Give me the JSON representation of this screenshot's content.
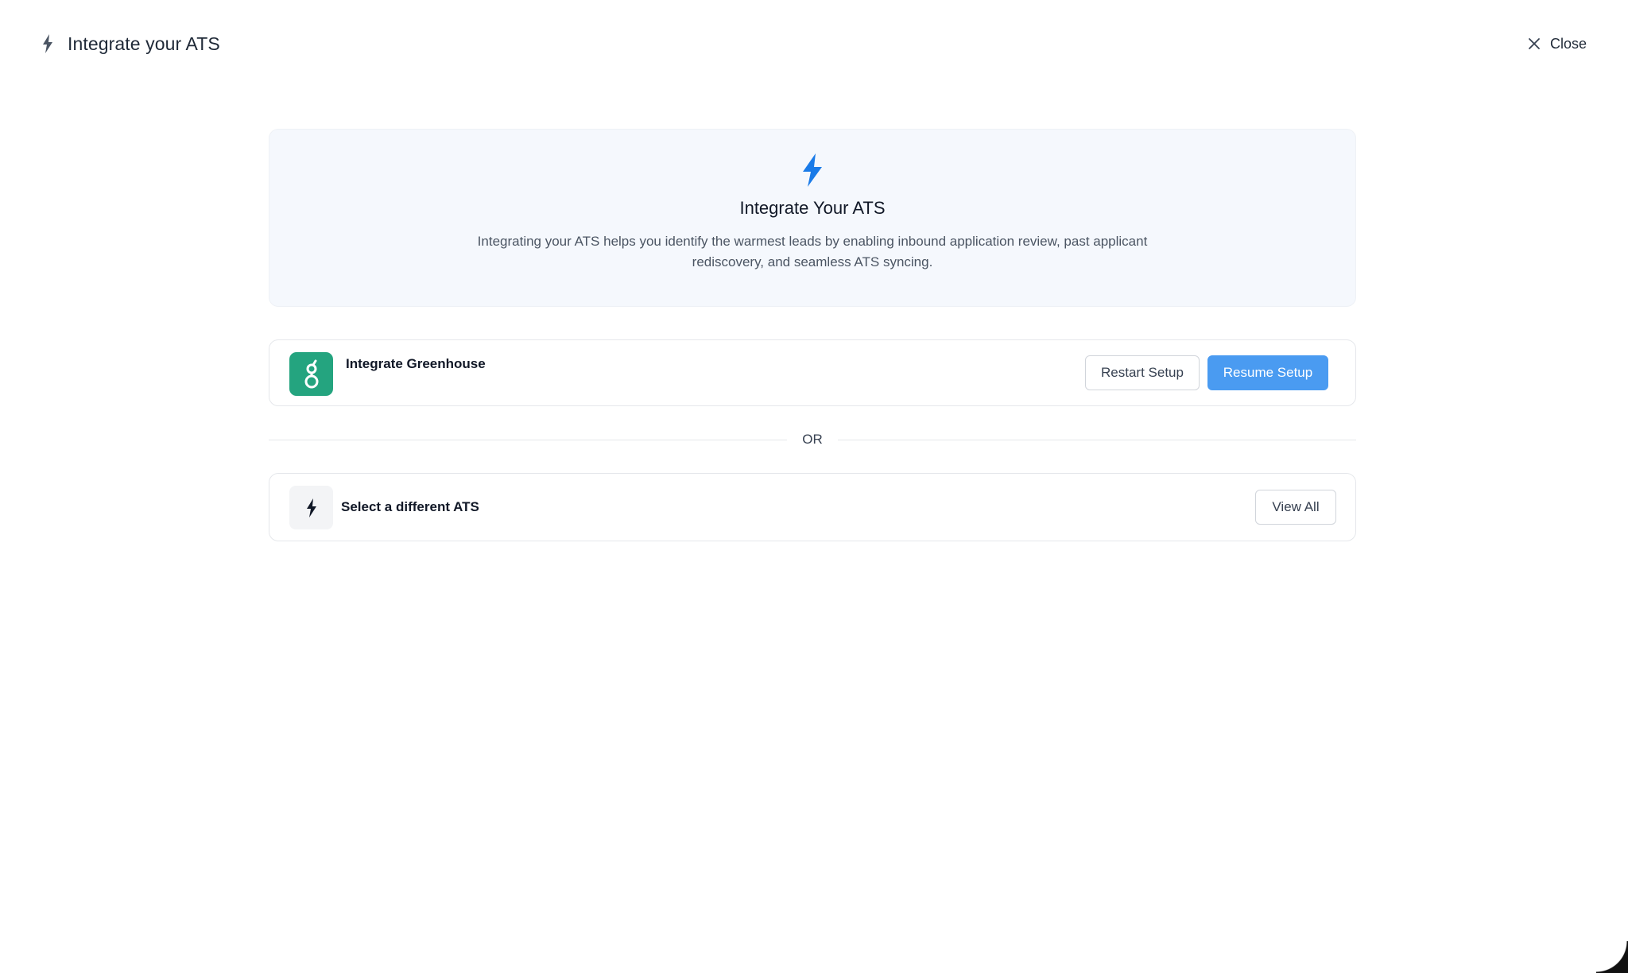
{
  "header": {
    "icon": "lightning-icon",
    "title": "Integrate your ATS",
    "close_label": "Close",
    "close_icon": "close-icon"
  },
  "hero": {
    "icon": "lightning-icon",
    "accent_color": "#1a7be8",
    "title": "Integrate Your ATS",
    "description": "Integrating your ATS helps you identify the warmest leads by enabling inbound application review, past applicant rediscovery, and seamless ATS syncing."
  },
  "greenhouse_card": {
    "logo_icon": "greenhouse-logo-icon",
    "logo_color": "#24a47f",
    "label": "Integrate Greenhouse",
    "restart_label": "Restart Setup",
    "resume_label": "Resume Setup",
    "primary_color": "#4a9bf1"
  },
  "divider": {
    "label": "OR"
  },
  "other_ats_card": {
    "icon": "lightning-icon",
    "label": "Select a different ATS",
    "view_all_label": "View All"
  }
}
